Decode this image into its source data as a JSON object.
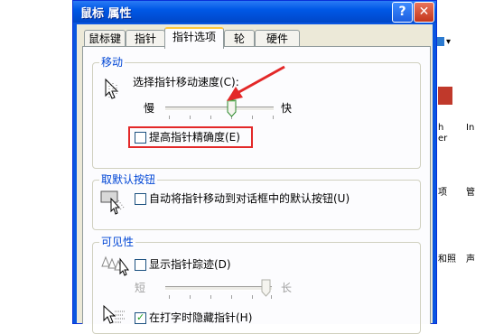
{
  "dialog": {
    "title": "鼠标 属性",
    "help_btn": "?",
    "close_btn": "✕"
  },
  "tabs": [
    {
      "label": "鼠标键"
    },
    {
      "label": "指针"
    },
    {
      "label": "指针选项"
    },
    {
      "label": "轮"
    },
    {
      "label": "硬件"
    }
  ],
  "motion": {
    "group_title": "移动",
    "speed_label": "选择指针移动速度(C):",
    "slow": "慢",
    "fast": "快",
    "speed_level": 0.6,
    "precision_label": "提高指针精确度(E)",
    "precision_checked": false
  },
  "snap": {
    "group_title": "取默认按钮",
    "snap_label": "自动将指针移动到对话框中的默认按钮(U)",
    "snap_checked": false
  },
  "visibility": {
    "group_title": "可见性",
    "trails_label": "显示指针踪迹(D)",
    "trails_checked": false,
    "short": "短",
    "long": "长",
    "trail_level": 0.95,
    "hide_label": "在打字时隐藏指针(H)",
    "hide_checked": true
  },
  "background_app": {
    "items": [
      "h",
      "er",
      "In",
      "项",
      "管",
      "和照",
      "声"
    ]
  },
  "colors": {
    "title_bar": "#0058e6",
    "annotation_red": "#e32828",
    "group_title": "#0046d5"
  }
}
